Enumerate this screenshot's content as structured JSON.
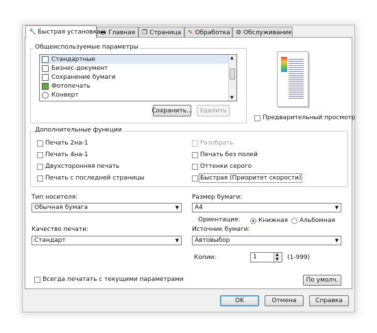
{
  "tabs": [
    {
      "label": "Быстрая установка",
      "icon": "quick-setup-icon"
    },
    {
      "label": "Главная",
      "icon": "main-icon"
    },
    {
      "label": "Страница",
      "icon": "page-setup-icon"
    },
    {
      "label": "Обработка",
      "icon": "processing-icon"
    },
    {
      "label": "Обслуживание",
      "icon": "maintenance-icon"
    }
  ],
  "common": {
    "title": "Общеиспользуемые параметры",
    "items": [
      "Стандартные",
      "Бизнес-документ",
      "Сохранение бумаги",
      "Фотопечать",
      "Конверт"
    ],
    "save_label": "Сохранить...",
    "delete_label": "Удалить"
  },
  "preview": {
    "label": "Предварительный просмотр",
    "checked": false
  },
  "extra": {
    "title": "Дополнительные функции",
    "left": [
      "Печать 2на-1",
      "Печать 4на-1",
      "Двухсторонняя печать",
      "Печать с последней страницы"
    ],
    "right": [
      "Разобрать",
      "Печать без полей",
      "Оттенки серого",
      "Быстрая (Приоритет скорости)"
    ]
  },
  "media": {
    "label": "Тип носителя:",
    "value": "Обычная бумага"
  },
  "paper_size": {
    "label": "Размер бумаги:",
    "value": "A4"
  },
  "orientation": {
    "label": "Ориентация:",
    "portrait": "Книжная",
    "landscape": "Альбомная",
    "selected": "portrait"
  },
  "quality": {
    "label": "Качество печати:",
    "value": "Стандарт"
  },
  "source": {
    "label": "Источник бумаги:",
    "value": "Автовыбор"
  },
  "copies": {
    "label": "Копии:",
    "value": "1",
    "range": "(1-999)"
  },
  "always_print": "Всегда печатать с текущими параметрами",
  "defaults_label": "По умолч.",
  "footer": {
    "ok": "OK",
    "cancel": "Отмена",
    "help": "Справка"
  }
}
